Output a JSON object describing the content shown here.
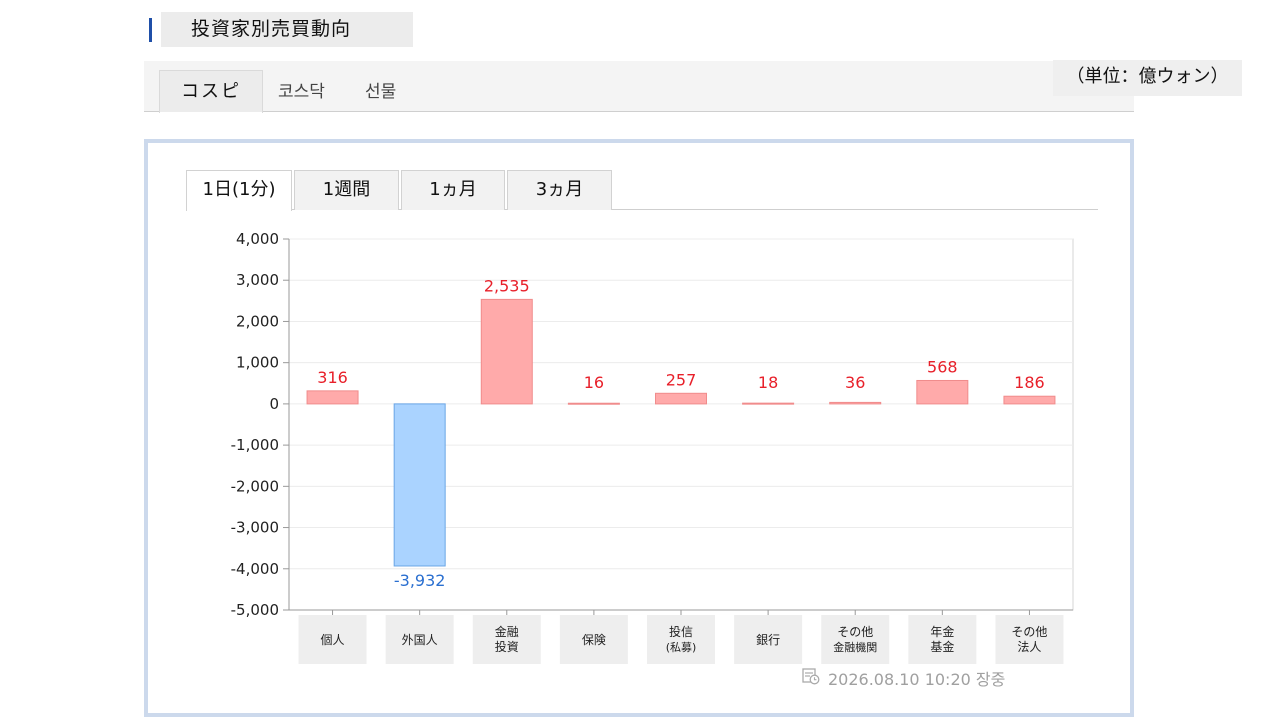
{
  "header": {
    "title": "投資家別売買動向",
    "unit": "（単位：億ウォン）"
  },
  "market_tabs": [
    "コスピ",
    "코스닥",
    "선물"
  ],
  "period_tabs": [
    "1日(1分)",
    "1週間",
    "1ヵ月",
    "3ヵ月"
  ],
  "timestamp": "2026.08.10 10:20 장중",
  "colors": {
    "positive_fill": "#ffaaaa",
    "positive_stroke": "#f08c8c",
    "positive_text": "#e8202a",
    "negative_fill": "#aad3ff",
    "negative_stroke": "#6aa6e6",
    "negative_text": "#2a6fd0"
  },
  "chart_data": {
    "type": "bar",
    "categories": [
      [
        "個人"
      ],
      [
        "外国人"
      ],
      [
        "金融",
        "投資"
      ],
      [
        "保険"
      ],
      [
        "投信",
        "(私募)"
      ],
      [
        "銀行"
      ],
      [
        "その他",
        "金融機関"
      ],
      [
        "年金",
        "基金"
      ],
      [
        "その他",
        "法人"
      ]
    ],
    "values": [
      316,
      -3932,
      2535,
      16,
      257,
      18,
      36,
      568,
      186
    ],
    "value_labels": [
      "316",
      "-3,932",
      "2,535",
      "16",
      "257",
      "18",
      "36",
      "568",
      "186"
    ],
    "yticks": [
      "4,000",
      "3,000",
      "2,000",
      "1,000",
      "0",
      "-1,000",
      "-2,000",
      "-3,000",
      "-4,000",
      "-5,000"
    ],
    "ylim": [
      -5000,
      4000
    ],
    "grid": true,
    "legend": "none"
  }
}
